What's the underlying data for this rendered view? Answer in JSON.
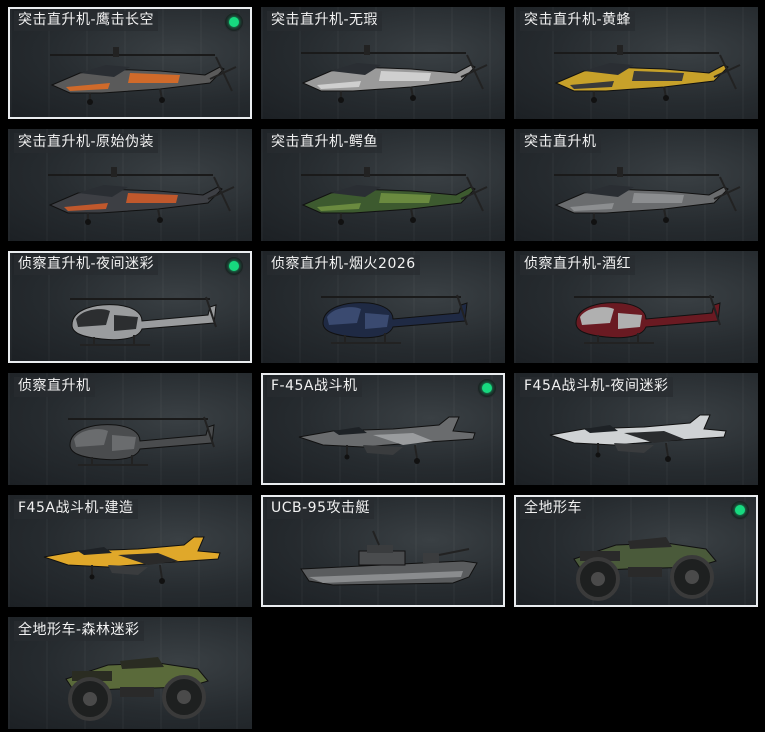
{
  "cards": [
    {
      "name": "突击直升机-鹰击长空",
      "selected": true,
      "equipped": true,
      "type": "heli",
      "colors": [
        "#5a5a5a",
        "#d06a2a"
      ]
    },
    {
      "name": "突击直升机-无瑕",
      "selected": false,
      "equipped": false,
      "type": "heli",
      "colors": [
        "#9a9a9a",
        "#cfcfcf"
      ]
    },
    {
      "name": "突击直升机-黄蜂",
      "selected": false,
      "equipped": false,
      "type": "heli",
      "colors": [
        "#c7a12a",
        "#3a3a3a"
      ]
    },
    {
      "name": "突击直升机-原始伪装",
      "selected": false,
      "equipped": false,
      "type": "heli",
      "colors": [
        "#3d3f44",
        "#c0582c"
      ]
    },
    {
      "name": "突击直升机-鳄鱼",
      "selected": false,
      "equipped": false,
      "type": "heli",
      "colors": [
        "#3d5a2f",
        "#6a8a3f"
      ]
    },
    {
      "name": "突击直升机",
      "selected": false,
      "equipped": false,
      "type": "heli",
      "colors": [
        "#6a6c6e",
        "#8c8e90"
      ]
    },
    {
      "name": "侦察直升机-夜间迷彩",
      "selected": true,
      "equipped": true,
      "type": "scout",
      "colors": [
        "#9a9c9e",
        "#2c2e30"
      ]
    },
    {
      "name": "侦察直升机-烟火2026",
      "selected": false,
      "equipped": false,
      "type": "scout",
      "colors": [
        "#1f2a44",
        "#3a4a70"
      ]
    },
    {
      "name": "侦察直升机-酒红",
      "selected": false,
      "equipped": false,
      "type": "scout",
      "colors": [
        "#6a1a22",
        "#b0b0b0"
      ]
    },
    {
      "name": "侦察直升机",
      "selected": false,
      "equipped": false,
      "type": "scout",
      "colors": [
        "#4a4c4e",
        "#6a6c6e"
      ]
    },
    {
      "name": "F-45A战斗机",
      "selected": true,
      "equipped": true,
      "type": "jet",
      "colors": [
        "#6a6c6e",
        "#9a9c9e"
      ]
    },
    {
      "name": "F45A战斗机-夜间迷彩",
      "selected": false,
      "equipped": false,
      "type": "jet",
      "colors": [
        "#cfd2d4",
        "#2a2c2e"
      ]
    },
    {
      "name": "F45A战斗机-建造",
      "selected": false,
      "equipped": false,
      "type": "jet",
      "colors": [
        "#e0a82a",
        "#2a2a2a"
      ]
    },
    {
      "name": "UCB-95攻击艇",
      "selected": true,
      "equipped": false,
      "type": "boat",
      "colors": [
        "#5a5c5e",
        "#8a8c8e"
      ]
    },
    {
      "name": "全地形车",
      "selected": true,
      "equipped": true,
      "type": "atv",
      "colors": [
        "#4a5a3a",
        "#2a2a2a"
      ]
    },
    {
      "name": "全地形车-森林迷彩",
      "selected": false,
      "equipped": false,
      "type": "atv",
      "colors": [
        "#5a6a3a",
        "#2a2c22"
      ]
    }
  ]
}
